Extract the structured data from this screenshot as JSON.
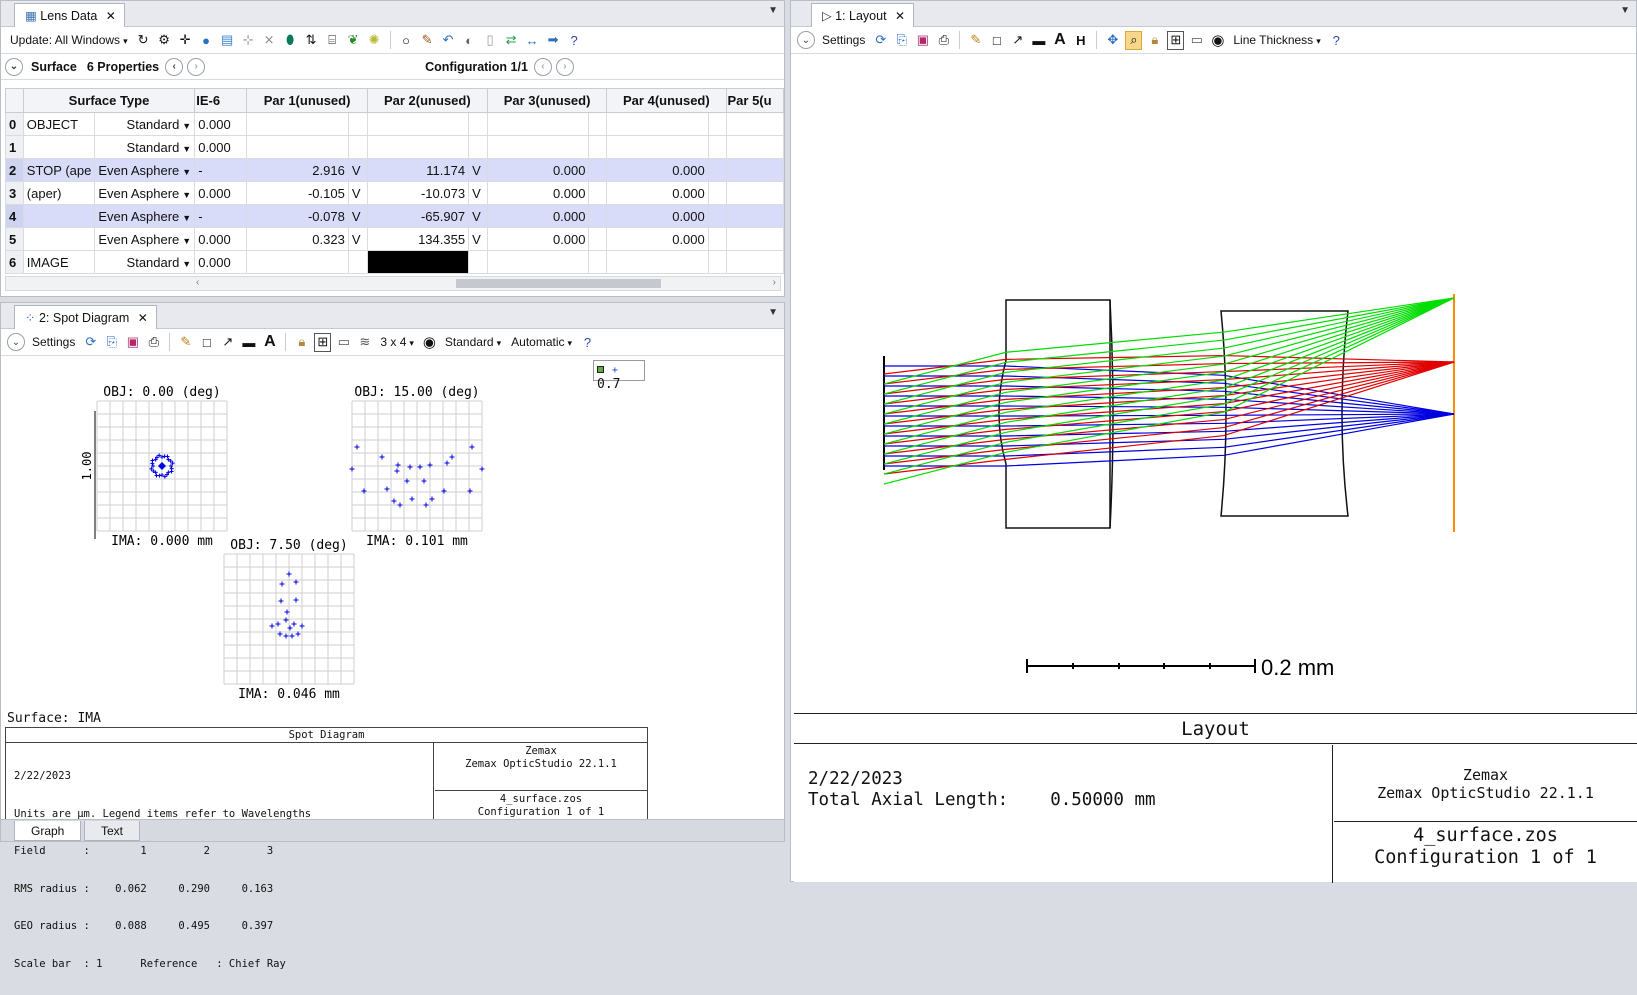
{
  "lens_panel": {
    "tab_title": "Lens Data",
    "update_label": "Update: All Windows",
    "surface_label": "Surface",
    "properties_label": "6 Properties",
    "configuration_label": "Configuration 1/1",
    "columns": [
      "Surface Type",
      "IE-6",
      "Par 1(unused)",
      "Par 2(unused)",
      "Par 3(unused)",
      "Par 4(unused)",
      "Par 5(u"
    ],
    "rows": [
      {
        "num": "0",
        "comment": "OBJECT",
        "type": "Standard",
        "ie6": "0.000",
        "p1": "",
        "p1v": "",
        "p2": "",
        "p2v": "",
        "p3": "",
        "p4": ""
      },
      {
        "num": "1",
        "comment": "",
        "type": "Standard",
        "ie6": "0.000",
        "p1": "",
        "p1v": "",
        "p2": "",
        "p2v": "",
        "p3": "",
        "p4": ""
      },
      {
        "num": "2",
        "comment": "STOP (ape",
        "type": "Even Asphere",
        "ie6": "-",
        "p1": "2.916",
        "p1v": "V",
        "p2": "11.174",
        "p2v": "V",
        "p3": "0.000",
        "p4": "0.000"
      },
      {
        "num": "3",
        "comment": "(aper)",
        "type": "Even Asphere",
        "ie6": "0.000",
        "p1": "-0.105",
        "p1v": "V",
        "p2": "-10.073",
        "p2v": "V",
        "p3": "0.000",
        "p4": "0.000"
      },
      {
        "num": "4",
        "comment": "",
        "type": "Even Asphere",
        "ie6": "-",
        "p1": "-0.078",
        "p1v": "V",
        "p2": "-65.907",
        "p2v": "V",
        "p3": "0.000",
        "p4": "0.000"
      },
      {
        "num": "5",
        "comment": "",
        "type": "Even Asphere",
        "ie6": "0.000",
        "p1": "0.323",
        "p1v": "V",
        "p2": "134.355",
        "p2v": "V",
        "p3": "0.000",
        "p4": "0.000"
      },
      {
        "num": "6",
        "comment": "IMAGE",
        "type": "Standard",
        "ie6": "0.000",
        "p1": "",
        "p1v": "",
        "p2": "",
        "p2v": "",
        "p3": "",
        "p4": ""
      }
    ]
  },
  "spot_panel": {
    "tab_title": "2: Spot Diagram",
    "settings_label": "Settings",
    "grid_label": "3 x 4",
    "standard_label": "Standard",
    "automatic_label": "Automatic",
    "legend_value": "0.7",
    "scale_label": "1.00",
    "fields": [
      {
        "obj": "OBJ: 0.00 (deg)",
        "ima": "IMA: 0.000 mm"
      },
      {
        "obj": "OBJ: 15.00 (deg)",
        "ima": "IMA: 0.101 mm"
      },
      {
        "obj": "OBJ: 7.50 (deg)",
        "ima": "IMA: 0.046 mm"
      }
    ],
    "surface_label": "Surface: IMA",
    "info": {
      "title": "Spot Diagram",
      "date": "2/22/2023",
      "units_line": "Units are µm. Legend items refer to Wavelengths",
      "field_line": "Field      :        1         2         3",
      "rms_line": "RMS radius :    0.062     0.290     0.163",
      "geo_line": "GEO radius :    0.088     0.495     0.397",
      "scale_line": "Scale bar  : 1      Reference   : Chief Ray",
      "company": "Zemax",
      "product": "Zemax OpticStudio 22.1.1",
      "file": "4_surface.zos",
      "config": "Configuration 1 of 1"
    },
    "bottom_tabs": [
      "Graph",
      "Text"
    ]
  },
  "layout_panel": {
    "tab_title": "1: Layout",
    "settings_label": "Settings",
    "line_thickness_label": "Line Thickness",
    "scale_bar_label": "0.2 mm",
    "title": "Layout",
    "date": "2/22/2023",
    "axial_label": "Total Axial Length:",
    "axial_value": "0.50000 mm",
    "company": "Zemax",
    "product": "Zemax OpticStudio 22.1.1",
    "file": "4_surface.zos",
    "config": "Configuration 1 of 1"
  },
  "colors": {
    "wavelength_1": "#0000e0",
    "wavelength_2": "#00dd00",
    "wavelength_3": "#e00000",
    "image_plane": "#ff8c00",
    "selected_row": "#d9dcf8"
  }
}
